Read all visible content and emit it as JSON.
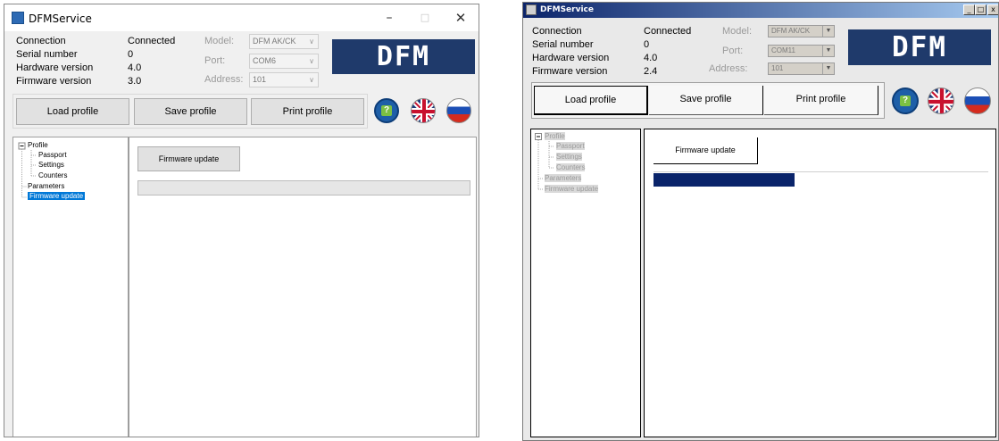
{
  "left_window": {
    "title": "DFMService",
    "controls": {
      "minimize": "–",
      "maximize": "□",
      "close": "✕"
    },
    "info": {
      "connection_label": "Connection",
      "connection_value": "Connected",
      "serial_label": "Serial number",
      "serial_value": "0",
      "hardware_label": "Hardware version",
      "hardware_value": "4.0",
      "firmware_label": "Firmware version",
      "firmware_value": "3.0"
    },
    "settings": {
      "model_label": "Model:",
      "model_value": "DFM AK/CK",
      "port_label": "Port:",
      "port_value": "COM6",
      "address_label": "Address:",
      "address_value": "101"
    },
    "logo_text": "DFM",
    "buttons": {
      "load": "Load profile",
      "save": "Save profile",
      "print": "Print profile"
    },
    "tree": {
      "profile": "Profile",
      "passport": "Passport",
      "settings": "Settings",
      "counters": "Counters",
      "parameters": "Parameters",
      "firmware": "Firmware update"
    },
    "panel": {
      "firmware_button": "Firmware update",
      "progress": 0
    }
  },
  "right_window": {
    "title": "DFMService",
    "controls": {
      "minimize": "_",
      "maximize": "□",
      "close": "x"
    },
    "info": {
      "connection_label": "Connection",
      "connection_value": "Connected",
      "serial_label": "Serial number",
      "serial_value": "0",
      "hardware_label": "Hardware version",
      "hardware_value": "4.0",
      "firmware_label": "Firmware version",
      "firmware_value": "2.4"
    },
    "settings": {
      "model_label": "Model:",
      "model_value": "DFM AK/CK",
      "port_label": "Port:",
      "port_value": "COM11",
      "address_label": "Address:",
      "address_value": "101"
    },
    "logo_text": "DFM",
    "buttons": {
      "load": "Load profile",
      "save": "Save profile",
      "print": "Print profile"
    },
    "tree": {
      "profile": "Profile",
      "passport": "Passport",
      "settings": "Settings",
      "counters": "Counters",
      "parameters": "Parameters",
      "firmware": "Firmware update"
    },
    "panel": {
      "firmware_button": "Firmware update",
      "progress": 0.42
    }
  },
  "colors": {
    "logo_bg": "#1f3a6b",
    "progress_fill": "#0a246a",
    "selection": "#0078d7",
    "title_gradient_start": "#0b246a"
  },
  "icons": [
    "app-icon",
    "help-icon",
    "uk-flag-icon",
    "russia-flag-icon",
    "minus-box-icon"
  ]
}
